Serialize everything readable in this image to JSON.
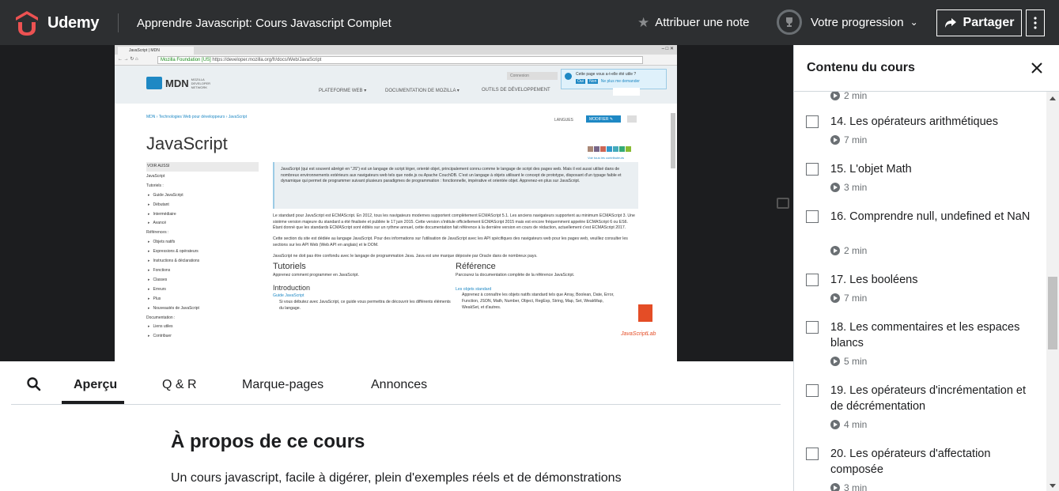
{
  "header": {
    "brand": "Udemy",
    "course_title": "Apprendre Javascript: Cours Javascript Complet",
    "rate_label": "Attribuer une note",
    "progress_label": "Votre progression",
    "share_label": "Partager"
  },
  "video": {
    "browser": {
      "tab_title": "JavaScript | MDN",
      "window_controls": "–  □  ✕",
      "site_identity": "Mozilla Foundation [US]",
      "url": "https://developer.mozilla.org/fr/docs/Web/JavaScript"
    },
    "mdn": {
      "logo_text": "MDN",
      "logo_sub": "MOZILLA DEVELOPER NETWORK",
      "nav": [
        "PLATEFORME WEB ▾",
        "DOCUMENTATION DE MOZILLA ▾",
        "OUTILS DE DÉVELOPPEMENT",
        "VOTRE AVIS"
      ],
      "login": "Connexion",
      "popup_text": "Cette page vous a-t-elle été utile ?",
      "popup_yes": "Oui",
      "popup_no": "Non",
      "popup_dismiss": "Ne plus me demander",
      "breadcrumb": "MDN › Technologies Web pour développeurs › JavaScript",
      "langs": "LANGUES",
      "edit": "MODIFIER ✎",
      "title": "JavaScript",
      "contributors": "Voir tous les contributeurs",
      "sidebar": [
        {
          "t": "VOIR AUSSI",
          "h": true
        },
        {
          "t": "JavaScript",
          "h": false,
          "plain": true
        },
        {
          "t": "Tutoriels :",
          "h": false,
          "plain": true
        },
        {
          "t": "Guide JavaScript",
          "h": false
        },
        {
          "t": "Débutant",
          "h": false
        },
        {
          "t": "Intermédiaire",
          "h": false
        },
        {
          "t": "Avancé",
          "h": false
        },
        {
          "t": "Références :",
          "h": false,
          "plain": true
        },
        {
          "t": "Objets natifs",
          "h": false
        },
        {
          "t": "Expressions & opérateurs",
          "h": false
        },
        {
          "t": "Instructions & déclarations",
          "h": false
        },
        {
          "t": "Fonctions",
          "h": false
        },
        {
          "t": "Classes",
          "h": false
        },
        {
          "t": "Erreurs",
          "h": false
        },
        {
          "t": "Plus",
          "h": false
        },
        {
          "t": "Nouveautés de JavaScript",
          "h": false
        },
        {
          "t": "Documentation :",
          "h": false,
          "plain": true
        },
        {
          "t": "Liens utiles",
          "h": false
        },
        {
          "t": "Contribuer",
          "h": false
        }
      ],
      "summary": "JavaScript (qui est souvent abrégé en \"JS\") est un langage de script léger, orienté objet, principalement connu comme le langage de script des pages web. Mais il est aussi utilisé dans de nombreux environnements extérieurs aux navigateurs web tels que node.js ou Apache CouchDB. C'est un langage à objets utilisant le concept de prototype, disposant d'un typage faible et dynamique qui permet de programmer suivant plusieurs paradigmes de programmation : fonctionnelle, impérative et orientée objet. Apprenez-en plus sur JavaScript.",
      "p1": "Le standard pour JavaScript est ECMAScript. En 2012, tous les navigateurs modernes supportent complètement ECMAScript 5.1. Les anciens navigateurs supportent au minimum ECMAScript 3. Une sixième version majeure du standard a été finalisée et publiée le 17 juin 2015. Cette version s'intitule officiellement ECMAScript 2015 mais est encore fréquemment appelée ECMAScript 6 ou ES6. Étant donné que les standards ECMAScript sont édités sur un rythme annuel, cette documentation fait référence à la dernière version en cours de rédaction, actuellement c'est ECMAScript 2017.",
      "p2": "Cette section du site est dédiée au langage JavaScript. Pour des informations sur l'utilisation de JavaScript avec les API spécifiques des navigateurs web pour les pages web, veuillez consulter les sections sur les API Web (Web API en anglais) et le DOM.",
      "p3": "JavaScript ne doit pas être confondu avec le langage de programmation Java. Java est une marque déposée par Oracle dans de nombreux pays.",
      "col1_title": "Tutoriels",
      "col1_text": "Apprenez comment programmer en JavaScript.",
      "col1_sub": "Introduction",
      "col1_link": "Guide JavaScript",
      "col1_link_text": "Si vous débutez avec JavaScript, ce guide vous permettra de découvrir les différents éléments du langage.",
      "col2_title": "Référence",
      "col2_text": "Parcourez la documentation complète de la référence JavaScript.",
      "col2_link": "Les objets standard",
      "col2_link_text": "Apprenez à connaître les objets natifs standard tels que Array, Boolean, Date, Error, Function, JSON, Math, Number, Object, RegExp, String, Map, Set, WeakMap, WeakSet, et d'autres.",
      "js_badge": "JavaScriptLab"
    }
  },
  "tabs": {
    "items": [
      "Aperçu",
      "Q & R",
      "Marque-pages",
      "Annonces"
    ],
    "active": "Aperçu"
  },
  "about": {
    "title": "À propos de ce cours",
    "description": "Un cours javascript, facile à digérer, plein d'exemples réels et de démonstrations"
  },
  "sidebar": {
    "title": "Contenu du cours",
    "lessons": [
      {
        "title": "",
        "duration": "2 min",
        "partial": true
      },
      {
        "title": "14. Les opérateurs arithmétiques",
        "duration": "7 min"
      },
      {
        "title": "15. L'objet Math",
        "duration": "3 min"
      },
      {
        "title": "16. Comprendre null, undefined et NaN",
        "duration": "2 min"
      },
      {
        "title": "17. Les booléens",
        "duration": "7 min"
      },
      {
        "title": "18. Les commentaires et les espaces blancs",
        "duration": "5 min"
      },
      {
        "title": "19. Les opérateurs d'incrémentation et de décrémentation",
        "duration": "4 min"
      },
      {
        "title": "20. Les opérateurs d'affectation composée",
        "duration": "3 min"
      }
    ]
  },
  "colors": {
    "header_bg": "#2d2f31",
    "brand": "#a435f0",
    "logo_red": "#ec5252",
    "link": "#1e88c4"
  }
}
